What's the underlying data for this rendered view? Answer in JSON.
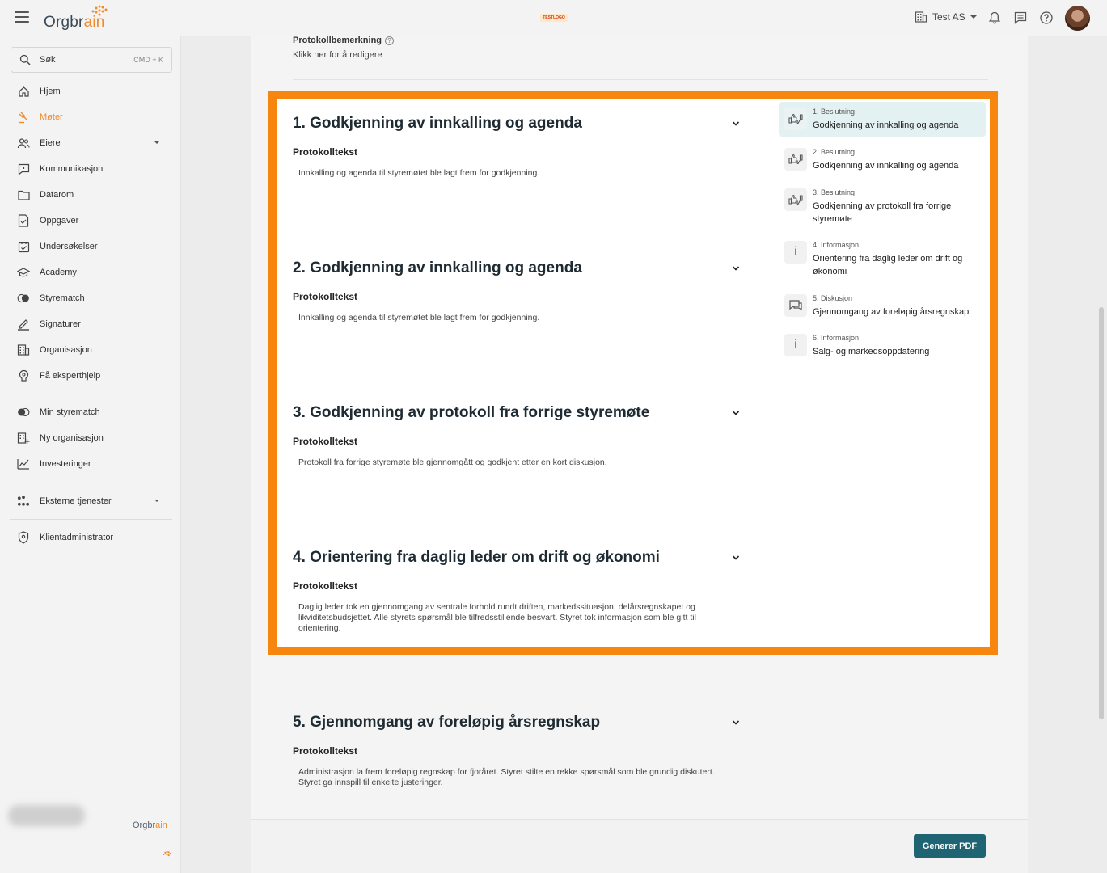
{
  "header": {
    "logo_prefix": "Orgbr",
    "logo_accent": "ain",
    "center_logo_text": "TESTLOGO",
    "org_name": "Test AS",
    "icons": [
      "menu-icon",
      "building-icon",
      "bell-icon",
      "chat-icon",
      "help-icon",
      "avatar"
    ]
  },
  "sidebar": {
    "search": {
      "label": "Søk",
      "hint": "CMD + K"
    },
    "items": [
      {
        "label": "Hjem",
        "icon": "home-icon"
      },
      {
        "label": "Møter",
        "icon": "gavel-icon",
        "active": true
      },
      {
        "label": "Eiere",
        "icon": "owners-icon",
        "expandable": true
      },
      {
        "label": "Kommunikasjon",
        "icon": "message-icon"
      },
      {
        "label": "Datarom",
        "icon": "folder-icon"
      },
      {
        "label": "Oppgaver",
        "icon": "task-icon"
      },
      {
        "label": "Undersøkelser",
        "icon": "survey-icon"
      },
      {
        "label": "Academy",
        "icon": "academy-icon"
      },
      {
        "label": "Styrematch",
        "icon": "match-icon"
      },
      {
        "label": "Signaturer",
        "icon": "signature-icon"
      },
      {
        "label": "Organisasjon",
        "icon": "organization-icon"
      },
      {
        "label": "Få eksperthjelp",
        "icon": "expert-icon"
      }
    ],
    "items2": [
      {
        "label": "Min styrematch",
        "icon": "match-icon"
      },
      {
        "label": "Ny organisasjon",
        "icon": "new-organization-icon"
      },
      {
        "label": "Investeringer",
        "icon": "chart-icon"
      }
    ],
    "items3": [
      {
        "label": "Eksterne tjenester",
        "icon": "services-icon",
        "expandable": true
      }
    ],
    "items4": [
      {
        "label": "Klientadministrator",
        "icon": "shield-icon"
      }
    ],
    "footer_logo_prefix": "Orgbr",
    "footer_logo_accent": "ain"
  },
  "main": {
    "remark_title": "Protokollbemerkning",
    "remark_link": "Klikk her for å redigere",
    "agenda": [
      {
        "title": "1. Godkjenning av innkalling og agenda",
        "sub": "Protokolltekst",
        "text": "Innkalling og agenda til styremøtet ble lagt frem for godkjenning."
      },
      {
        "title": "2. Godkjenning av innkalling og agenda",
        "sub": "Protokolltekst",
        "text": "Innkalling og agenda til styremøtet ble lagt frem for godkjenning."
      },
      {
        "title": "3. Godkjenning av protokoll fra forrige styremøte",
        "sub": "Protokolltekst",
        "text": "Protokoll fra forrige styremøte ble gjennomgått og godkjent etter en kort diskusjon."
      },
      {
        "title": "4. Orientering fra daglig leder om drift og økonomi",
        "sub": "Protokolltekst",
        "text": "Daglig leder tok en gjennomgang av sentrale forhold rundt driften, markedssituasjon, delårsregnskapet og likviditetsbudsjettet. Alle styrets spørsmål ble tilfredsstillende besvart. Styret tok informasjon som ble gitt til orientering."
      },
      {
        "title": "5. Gjennomgang av foreløpig årsregnskap",
        "sub": "Protokolltekst",
        "text": "Administrasjon la frem foreløpig regnskap for fjoråret. Styret stilte en rekke spørsmål som ble grundig diskutert. Styret ga innspill til enkelte justeringer."
      }
    ],
    "toc": [
      {
        "kind": "1. Beslutning",
        "title": "Godkjenning av innkalling og agenda",
        "icon": "decision-icon"
      },
      {
        "kind": "2. Beslutning",
        "title": "Godkjenning av innkalling og agenda",
        "icon": "decision-icon"
      },
      {
        "kind": "3. Beslutning",
        "title": "Godkjenning av protokoll fra forrige styremøte",
        "icon": "decision-icon"
      },
      {
        "kind": "4. Informasjon",
        "title": "Orientering fra daglig leder om drift og økonomi",
        "icon": "info-icon"
      },
      {
        "kind": "5. Diskusjon",
        "title": "Gjennomgang av foreløpig årsregnskap",
        "icon": "discussion-icon"
      },
      {
        "kind": "6. Informasjon",
        "title": "Salg- og markedsoppdatering",
        "icon": "info-icon"
      }
    ],
    "pdf_button": "Generer PDF"
  },
  "colors": {
    "accent": "#f08a2a",
    "highlight_border": "#f7860e",
    "primary_button": "#1f6472",
    "toc_active": "#e4f1f3"
  }
}
